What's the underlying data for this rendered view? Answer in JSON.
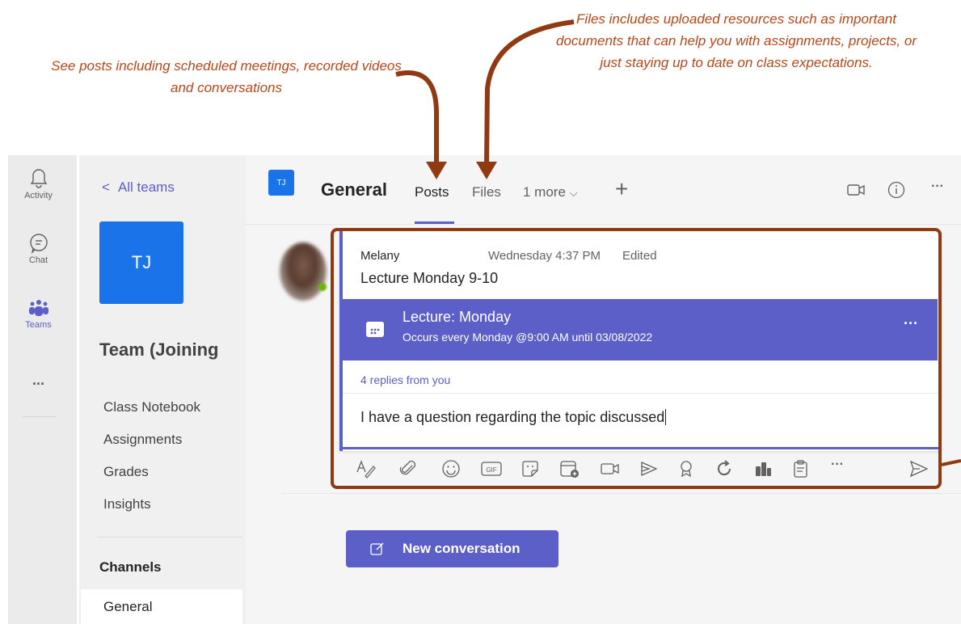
{
  "annotations": {
    "posts_note": "See posts including scheduled meetings, recorded videos and conversations",
    "files_note": "Files includes uploaded resources such as important documents that can help you with assignments, projects, or just staying up to date on class expectations.",
    "color": "#b5481a"
  },
  "rail": {
    "items": [
      {
        "label": "Activity",
        "icon": "bell-icon"
      },
      {
        "label": "Chat",
        "icon": "chat-icon"
      },
      {
        "label": "Teams",
        "icon": "teams-icon"
      }
    ],
    "more": "..."
  },
  "sidebar": {
    "back_label": "All teams",
    "back_chevron": "<",
    "team_initials": "TJ",
    "team_name": "Team (Joining",
    "links": [
      "Class Notebook",
      "Assignments",
      "Grades",
      "Insights"
    ],
    "channels_heading": "Channels",
    "channels": [
      "General"
    ]
  },
  "header": {
    "initials": "TJ",
    "channel": "General",
    "tabs": [
      "Posts",
      "Files",
      "1 more"
    ],
    "more_chevron": "⌵",
    "add": "+",
    "overflow": "···"
  },
  "post": {
    "author": "Melany",
    "time": "Wednesday 4:37 PM",
    "edited": "Edited",
    "message": "Lecture Monday  9-10",
    "meeting_title": "Lecture: Monday",
    "meeting_sub": "Occurs every Monday @9:00 AM until 03/08/2022",
    "meeting_more": "···",
    "replies": "4 replies from you",
    "reply_draft": "I have a question regarding the topic discussed"
  },
  "toolbar": {
    "icons": [
      "format-icon",
      "attach-icon",
      "emoji-icon",
      "gif-icon",
      "sticker-icon",
      "schedule-meeting-icon",
      "video-icon",
      "stream-icon",
      "praise-icon",
      "loop-icon",
      "app-icon",
      "clipboard-icon",
      "more-icon",
      "send-icon"
    ],
    "gif_label": "GIF",
    "more": "···"
  },
  "new_conversation": "New conversation",
  "colors": {
    "accent": "#5b5fc7",
    "team_blue": "#1a73e8",
    "highlight": "#8f3a12"
  }
}
